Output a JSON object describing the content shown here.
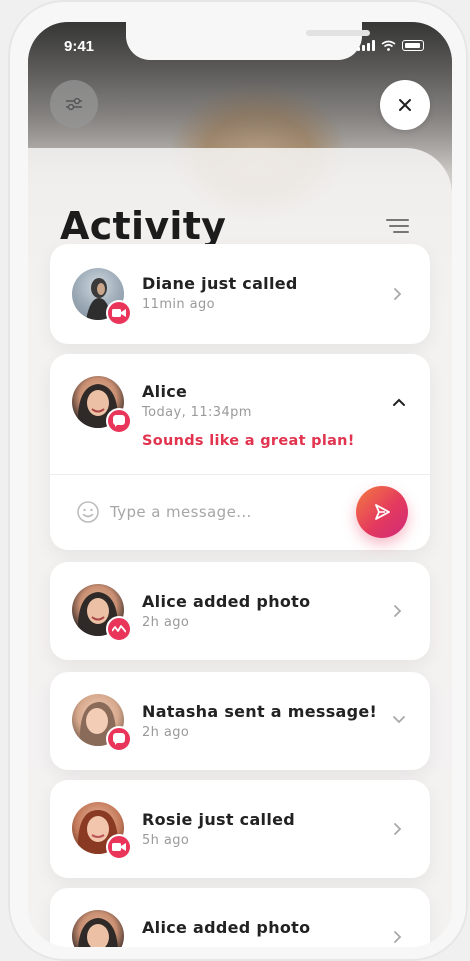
{
  "status_bar": {
    "time": "9:41"
  },
  "header": {
    "title": "Activity",
    "filter_icon": "sliders-icon",
    "close_icon": "close-icon",
    "sort_icon": "sort-lines-icon"
  },
  "activities": [
    {
      "name": "Diane just called",
      "time": "11min ago",
      "badge_icon": "video-camera-icon",
      "chevron": "chevron-right-icon"
    },
    {
      "name": "Alice",
      "time": "Today, 11:34pm",
      "message": "Sounds like a great plan!",
      "badge_icon": "chat-bubble-icon",
      "chevron": "chevron-up-icon",
      "expanded": true
    },
    {
      "name": "Alice added photo",
      "time": "2h ago",
      "badge_icon": "activity-wave-icon",
      "chevron": "chevron-right-icon"
    },
    {
      "name": "Natasha sent a message!",
      "time": "2h ago",
      "badge_icon": "chat-bubble-icon",
      "chevron": "chevron-down-icon"
    },
    {
      "name": "Rosie just called",
      "time": "5h ago",
      "badge_icon": "video-camera-icon",
      "chevron": "chevron-right-icon"
    },
    {
      "name": "Alice added photo",
      "time": "",
      "badge_icon": "activity-wave-icon",
      "chevron": "chevron-right-icon"
    }
  ],
  "reply": {
    "placeholder": "Type a message...",
    "value": "",
    "send_icon": "send-icon",
    "emoji_icon": "smiley-icon"
  },
  "colors": {
    "accent": "#e9355a",
    "accent_gradient_start": "#f37b3f",
    "accent_gradient_end": "#cf2a7a",
    "message_text": "#e2334f"
  }
}
